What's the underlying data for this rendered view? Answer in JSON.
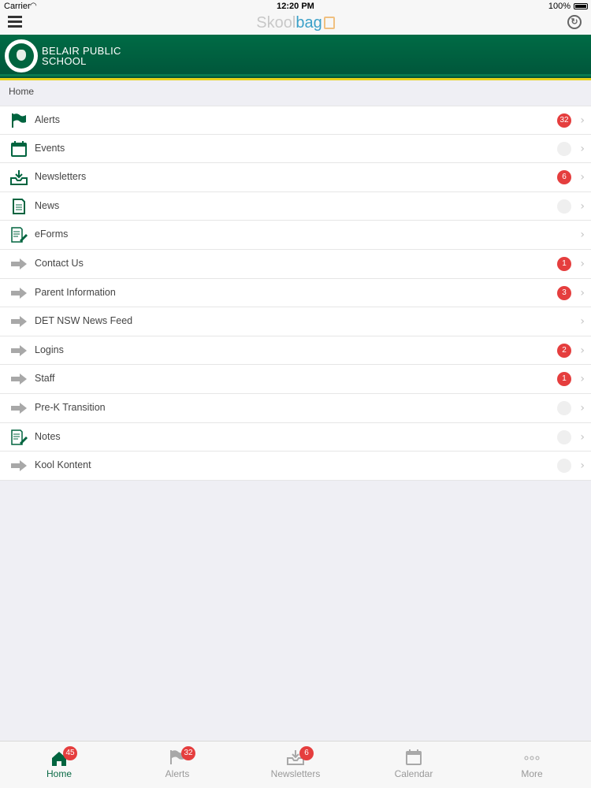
{
  "status_bar": {
    "carrier": "Carrier",
    "time": "12:20 PM",
    "battery": "100%"
  },
  "app": {
    "logo_part1": "Skool",
    "logo_part2": "bag"
  },
  "school": {
    "name_line1": "BELAIR PUBLIC",
    "name_line2": "SCHOOL"
  },
  "breadcrumb": "Home",
  "menu": [
    {
      "label": "Alerts",
      "icon": "flag-icon",
      "badge": "32"
    },
    {
      "label": "Events",
      "icon": "calendar-icon",
      "badge": ""
    },
    {
      "label": "Newsletters",
      "icon": "inbox-download-icon",
      "badge": "6"
    },
    {
      "label": "News",
      "icon": "document-icon",
      "badge": ""
    },
    {
      "label": "eForms",
      "icon": "form-edit-icon",
      "badge": null
    },
    {
      "label": "Contact Us",
      "icon": "arrow-right-icon",
      "badge": "1"
    },
    {
      "label": "Parent Information",
      "icon": "arrow-right-icon",
      "badge": "3"
    },
    {
      "label": "DET NSW News Feed",
      "icon": "arrow-right-icon",
      "badge": null
    },
    {
      "label": "Logins",
      "icon": "arrow-right-icon",
      "badge": "2"
    },
    {
      "label": "Staff",
      "icon": "arrow-right-icon",
      "badge": "1"
    },
    {
      "label": "Pre-K Transition",
      "icon": "arrow-right-icon",
      "badge": ""
    },
    {
      "label": "Notes",
      "icon": "form-edit-icon",
      "badge": ""
    },
    {
      "label": "Kool Kontent",
      "icon": "arrow-right-icon",
      "badge": ""
    }
  ],
  "tabs": [
    {
      "label": "Home",
      "icon": "home-icon",
      "badge": "45",
      "active": true
    },
    {
      "label": "Alerts",
      "icon": "flag-icon",
      "badge": "32",
      "active": false
    },
    {
      "label": "Newsletters",
      "icon": "inbox-download-icon",
      "badge": "6",
      "active": false
    },
    {
      "label": "Calendar",
      "icon": "calendar-icon",
      "badge": "",
      "active": false
    },
    {
      "label": "More",
      "icon": "more-icon",
      "badge": "",
      "active": false
    }
  ],
  "colors": {
    "brand_green": "#00643f",
    "badge_red": "#e53e3e",
    "accent_yellow": "#e6d21a"
  }
}
